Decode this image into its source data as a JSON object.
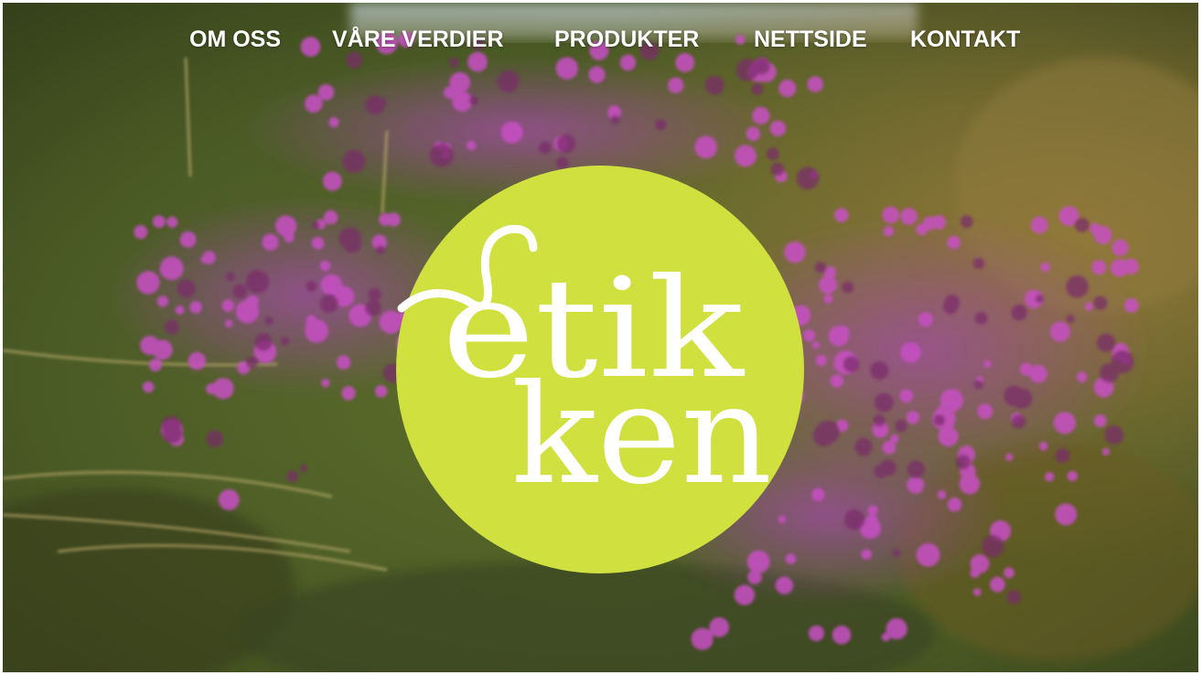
{
  "nav": {
    "items": [
      {
        "label": "OM OSS"
      },
      {
        "label": "VÅRE VERDIER"
      },
      {
        "label": "PRODUKTER"
      },
      {
        "label": "NETTSIDE"
      },
      {
        "label": "KONTAKT"
      }
    ]
  },
  "logo": {
    "line1": "etik",
    "line2": "ken"
  },
  "colors": {
    "logo_circle": "#cfe03f",
    "logo_text": "#ffffff",
    "nav_text": "#ffffff",
    "flower_pink": "#b03cb8"
  },
  "background": {
    "description_icon": "heather-flowers-photo"
  }
}
